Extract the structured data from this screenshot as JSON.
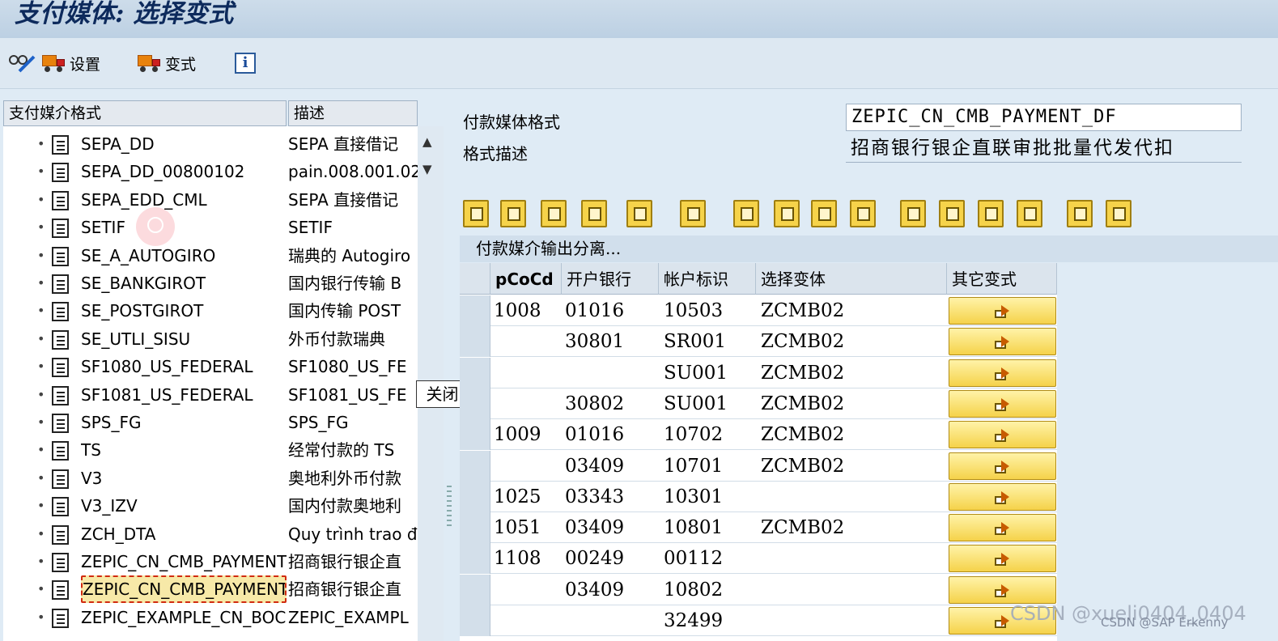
{
  "title": "支付媒体: 选择变式",
  "toolbar": {
    "settings_label": "设置",
    "variant_label": "变式"
  },
  "left": {
    "col_format": "支付媒介格式",
    "col_desc": "描述",
    "items": [
      {
        "name": "SEPA_DD",
        "desc": "SEPA 直接借记"
      },
      {
        "name": "SEPA_DD_00800102",
        "desc": "pain.008.001.02"
      },
      {
        "name": "SEPA_EDD_CML",
        "desc": "SEPA 直接借记"
      },
      {
        "name": "SETIF",
        "desc": "SETIF"
      },
      {
        "name": "SE_A_AUTOGIRO",
        "desc": "瑞典的 Autogiro"
      },
      {
        "name": "SE_BANKGIROT",
        "desc": "国内银行传输 B"
      },
      {
        "name": "SE_POSTGIROT",
        "desc": "国内传输 POST"
      },
      {
        "name": "SE_UTLI_SISU",
        "desc": "外币付款瑞典"
      },
      {
        "name": "SF1080_US_FEDERAL",
        "desc": "SF1080_US_FE"
      },
      {
        "name": "SF1081_US_FEDERAL",
        "desc": "SF1081_US_FE"
      },
      {
        "name": "SPS_FG",
        "desc": "SPS_FG"
      },
      {
        "name": "TS",
        "desc": "经常付款的 TS"
      },
      {
        "name": "V3",
        "desc": "奥地利外币付款"
      },
      {
        "name": "V3_IZV",
        "desc": "国内付款奥地利"
      },
      {
        "name": "ZCH_DTA",
        "desc": "Quy trình trao đ"
      },
      {
        "name": "ZEPIC_CN_CMB_PAYMENT",
        "desc": "招商银行银企直"
      },
      {
        "name": "ZEPIC_CN_CMB_PAYMENT",
        "desc": "招商银行银企直"
      },
      {
        "name": "ZEPIC_EXAMPLE_CN_BOC",
        "desc": "ZEPIC_EXAMPL"
      }
    ],
    "tooltip": "关闭"
  },
  "form": {
    "format_label": "付款媒体格式",
    "format_value": "ZEPIC_CN_CMB_PAYMENT_DF",
    "desc_label": "格式描述",
    "desc_value": "招商银行银企直联审批批量代发代扣"
  },
  "section_title": "付款媒介输出分离...",
  "grid": {
    "headers": [
      "pCoCd",
      "开户银行",
      "帐户标识",
      "选择变体",
      "其它变式"
    ],
    "rows": [
      [
        "1008",
        "01016",
        "10503",
        "ZCMB02"
      ],
      [
        "",
        "30801",
        "SR001",
        "ZCMB02"
      ],
      [
        "",
        "",
        "SU001",
        "ZCMB02"
      ],
      [
        "",
        "30802",
        "SU001",
        "ZCMB02"
      ],
      [
        "1009",
        "01016",
        "10702",
        "ZCMB02"
      ],
      [
        "",
        "03409",
        "10701",
        "ZCMB02"
      ],
      [
        "1025",
        "03343",
        "10301",
        ""
      ],
      [
        "1051",
        "03409",
        "10801",
        "ZCMB02"
      ],
      [
        "1108",
        "00249",
        "00112",
        ""
      ],
      [
        "",
        "03409",
        "10802",
        ""
      ],
      [
        "",
        "",
        "32499",
        ""
      ]
    ]
  },
  "watermark": "CSDN @xueli0404_0404",
  "watermark2": "CSDN @SAP Erkenny"
}
